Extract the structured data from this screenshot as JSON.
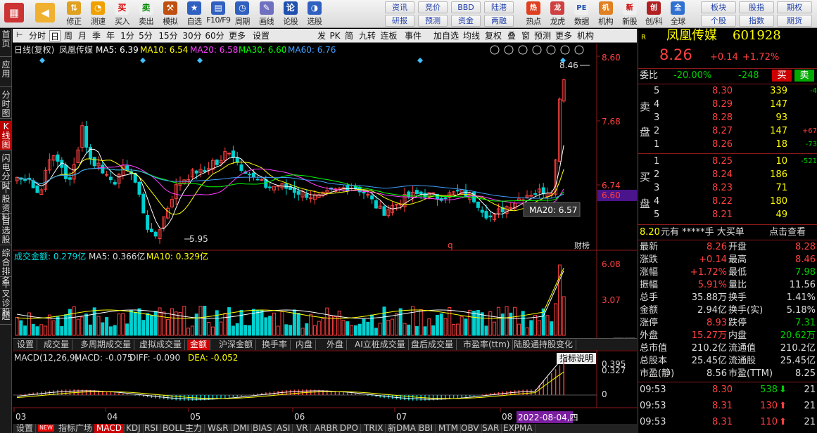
{
  "toolbar": {
    "buttons": [
      {
        "label": "修正",
        "icon": "up-down-arrows-icon"
      },
      {
        "label": "测速",
        "icon": "speedometer-icon"
      },
      {
        "label": "买入",
        "icon": "buy-icon",
        "glyph": "买"
      },
      {
        "label": "卖出",
        "icon": "sell-icon",
        "glyph": "卖"
      },
      {
        "label": "模拟",
        "icon": "hammer-icon"
      },
      {
        "label": "自选",
        "icon": "star-icon"
      },
      {
        "label": "F10/F9",
        "icon": "f10-icon"
      },
      {
        "label": "周期",
        "icon": "clock-icon"
      },
      {
        "label": "画线",
        "icon": "pencil-icon"
      },
      {
        "label": "论股",
        "icon": "discuss-icon",
        "glyph": "论"
      },
      {
        "label": "选股",
        "icon": "select-stock-icon"
      }
    ],
    "grid": [
      [
        "资讯",
        "竞价",
        "BBD",
        "陆港"
      ],
      [
        "研报",
        "预测",
        "资金",
        "两融"
      ]
    ],
    "right_buttons": [
      {
        "label": "热点",
        "glyph": "热"
      },
      {
        "label": "龙虎",
        "glyph": "龙"
      },
      {
        "label": "数据",
        "glyph": "PE"
      },
      {
        "label": "机构",
        "glyph": "机"
      },
      {
        "label": "新股",
        "glyph": "新"
      },
      {
        "label": "创/科",
        "glyph": "创"
      },
      {
        "label": "全球",
        "glyph": "全"
      }
    ],
    "far_grid": [
      [
        "板块",
        "股指",
        "期权"
      ],
      [
        "个股",
        "指数",
        "期货"
      ]
    ]
  },
  "left_tabs": [
    "首页",
    "应用",
    "分时图",
    "K线图",
    "闪电分时",
    "个股资料",
    "自选股",
    "综合排名",
    "牛叉诊股",
    "超"
  ],
  "period_bar": {
    "items": [
      "分时",
      "日",
      "周",
      "月",
      "季",
      "年",
      "1分",
      "5分",
      "15分",
      "30分",
      "60分",
      "更多",
      "设置"
    ],
    "active": "日",
    "right_items": [
      "发",
      "PK",
      "简",
      "九转",
      "连板",
      "事件"
    ],
    "tools": [
      "加自选",
      "均线",
      "复权",
      "叠",
      "窗",
      "预测",
      "更多",
      "机构"
    ]
  },
  "kline_header": {
    "period": "日线(复权)",
    "name": "凤凰传媒",
    "ma5": "MA5: 6.39",
    "ma10": "MA10: 6.54",
    "ma20": "MA20: 6.58",
    "ma30": "MA30: 6.60",
    "ma60": "MA60: 6.76"
  },
  "price_axis": [
    "8.60",
    "7.68",
    "6.74",
    "6.60"
  ],
  "price_annotations": {
    "high": "8.46",
    "low": "5.95",
    "tooltip": "MA20: 6.57",
    "marker_q": "q",
    "marker_cai": "财榜"
  },
  "volume_header": {
    "title": "成交金额: 0.279亿",
    "ma5": "MA5: 0.366亿",
    "ma10": "MA10: 0.329亿"
  },
  "volume_axis": [
    "6.08",
    "3.07"
  ],
  "indicator_tabs": [
    "设置",
    "成交量",
    "多周期成交量",
    "虚拟成交量",
    "金额",
    "沪深金额",
    "换手率",
    "内盘",
    "外盘",
    "AI立桩成交量",
    "盘后成交量",
    "市盈率(ttm)",
    "陆股通持股变化"
  ],
  "indicator_active": "金额",
  "macd_header": {
    "title": "MACD(12,26,9)",
    "macd": "MACD: -0.075",
    "diff": "DIFF: -0.090",
    "dea": "DEA: -0.052",
    "help": "指标说明"
  },
  "macd_axis": [
    "0.395",
    "0.327",
    "0"
  ],
  "x_axis": [
    "03",
    "04",
    "05",
    "06",
    "07",
    "08"
  ],
  "x_cursor_date": "2022-08-04,四",
  "bottom_tabs": [
    "设置",
    "指标广场",
    "MACD",
    "KDJ",
    "RSI",
    "BOLL",
    "主力",
    "W&R",
    "DMI",
    "BIAS",
    "ASI",
    "VR",
    "ARBR",
    "DPO",
    "TRIX",
    "新DMA",
    "BBI",
    "MTM",
    "OBV",
    "SAR",
    "EXPMA"
  ],
  "bottom_active": "MACD",
  "bottom_new_badge": "NEW",
  "quote": {
    "name": "凤凰传媒",
    "code": "601928",
    "price": "8.26",
    "change": "+0.14",
    "change_pct": "+1.72%",
    "weibi_label": "委比",
    "weibi": "-20.00%",
    "weicha": "-248",
    "buy_btn": "买",
    "sell_btn": "卖",
    "sell_label": "卖盘",
    "buy_label": "买盘",
    "asks": [
      {
        "level": "5",
        "price": "8.30",
        "vol": "339",
        "chg": "-4"
      },
      {
        "level": "4",
        "price": "8.29",
        "vol": "147",
        "chg": ""
      },
      {
        "level": "3",
        "price": "8.28",
        "vol": "93",
        "chg": ""
      },
      {
        "level": "2",
        "price": "8.27",
        "vol": "147",
        "chg": "+67"
      },
      {
        "level": "1",
        "price": "8.26",
        "vol": "18",
        "chg": "-73"
      }
    ],
    "bids": [
      {
        "level": "1",
        "price": "8.25",
        "vol": "10",
        "chg": "-521"
      },
      {
        "level": "2",
        "price": "8.24",
        "vol": "186",
        "chg": ""
      },
      {
        "level": "3",
        "price": "8.23",
        "vol": "71",
        "chg": ""
      },
      {
        "level": "4",
        "price": "8.22",
        "vol": "180",
        "chg": ""
      },
      {
        "level": "5",
        "price": "8.21",
        "vol": "49",
        "chg": ""
      }
    ],
    "big_order": {
      "price": "8.20",
      "text": "元有 *****手 大买单",
      "link": "点击查看"
    },
    "stats": [
      [
        "最新",
        "8.26",
        "开盘",
        "8.28"
      ],
      [
        "涨跌",
        "+0.14",
        "最高",
        "8.46"
      ],
      [
        "涨幅",
        "+1.72%",
        "最低",
        "7.98"
      ],
      [
        "振幅",
        "5.91%",
        "量比",
        "11.56"
      ],
      [
        "总手",
        "35.88万",
        "换手",
        "1.41%"
      ],
      [
        "金额",
        "2.94亿",
        "换手(实)",
        "5.18%"
      ],
      [
        "涨停",
        "8.93",
        "跌停",
        "7.31"
      ],
      [
        "外盘",
        "15.27万",
        "内盘",
        "20.62万"
      ],
      [
        "总市值",
        "210.2亿",
        "流通值",
        "210.2亿"
      ],
      [
        "总股本",
        "25.45亿",
        "流通股",
        "25.45亿"
      ],
      [
        "市盈(静)",
        "8.56",
        "市盈(TTM)",
        "8.25"
      ]
    ],
    "ticks": [
      {
        "time": "09:53",
        "price": "8.30",
        "vol": "538",
        "dir": "down",
        "n": "21"
      },
      {
        "time": "09:53",
        "price": "8.31",
        "vol": "130",
        "dir": "up",
        "n": "21"
      },
      {
        "time": "09:53",
        "price": "8.31",
        "vol": "110",
        "dir": "up",
        "n": "21"
      }
    ]
  },
  "colors": {
    "up": "#ff4040",
    "down": "#00d0d0",
    "ma5": "#ffffff",
    "ma10": "#ffff00",
    "ma20": "#ff40ff",
    "ma30": "#00ff00",
    "ma60": "#40a0ff"
  }
}
